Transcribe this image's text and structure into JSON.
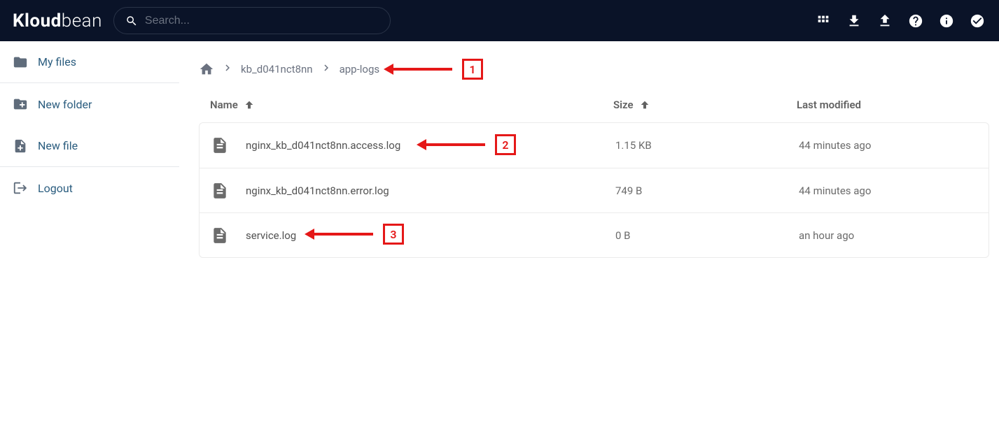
{
  "logo": {
    "bold": "Kloud",
    "thin": "bean"
  },
  "search": {
    "placeholder": "Search..."
  },
  "sidebar": {
    "items": [
      {
        "label": "My files"
      },
      {
        "label": "New folder"
      },
      {
        "label": "New file"
      },
      {
        "label": "Logout"
      }
    ]
  },
  "breadcrumb": {
    "items": [
      {
        "label": "kb_d041nct8nn"
      },
      {
        "label": "app-logs"
      }
    ]
  },
  "table": {
    "columns": {
      "name": "Name",
      "size": "Size",
      "modified": "Last modified"
    }
  },
  "files": [
    {
      "name": "nginx_kb_d041nct8nn.access.log",
      "size": "1.15 KB",
      "modified": "44 minutes ago"
    },
    {
      "name": "nginx_kb_d041nct8nn.error.log",
      "size": "749 B",
      "modified": "44 minutes ago"
    },
    {
      "name": "service.log",
      "size": "0 B",
      "modified": "an hour ago"
    }
  ],
  "annotations": [
    {
      "num": "1"
    },
    {
      "num": "2"
    },
    {
      "num": "3"
    }
  ]
}
